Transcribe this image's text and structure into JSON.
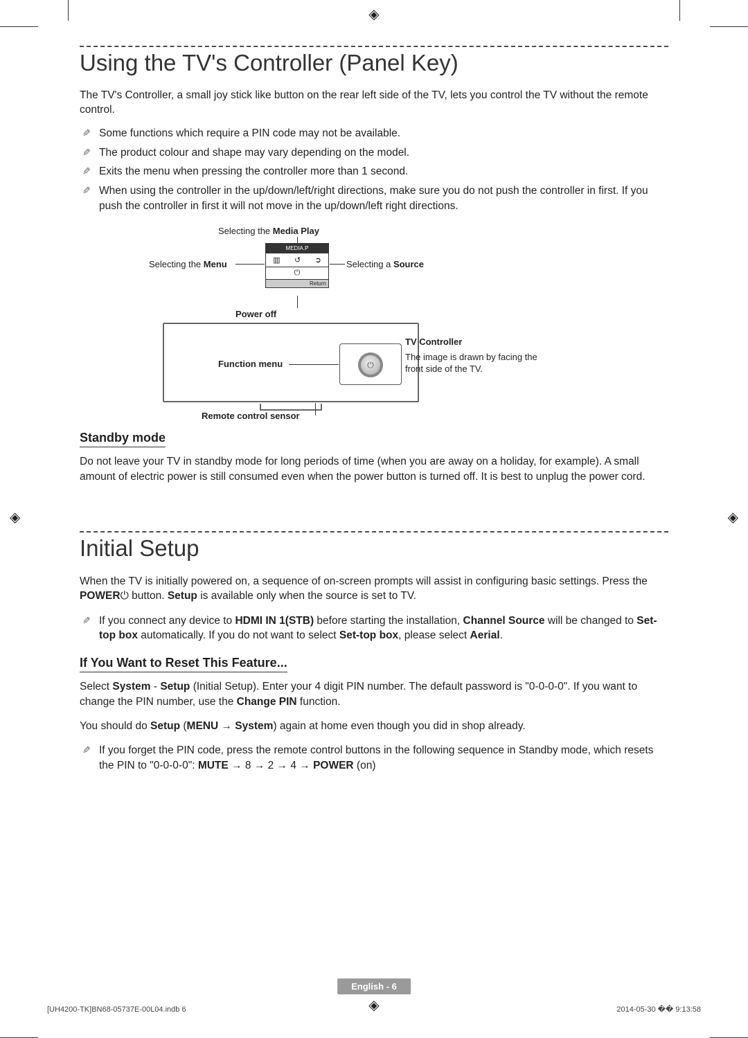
{
  "section1": {
    "title": "Using the TV's Controller (Panel Key)",
    "intro": "The TV's Controller, a small joy stick like button on the rear left side of the TV, lets you control the TV without the remote control.",
    "notes": [
      "Some functions which require a PIN code may not be available.",
      "The product colour and shape may vary depending on the model.",
      "Exits the menu when pressing the controller more than 1 second.",
      "When using the controller in the up/down/left/right directions, make sure you do not push the controller in first. If you push the controller in first it will not move in the up/down/left right directions."
    ],
    "diagram": {
      "media_play_prefix": "Selecting the ",
      "media_play_bold": "Media Play",
      "menu_prefix": "Selecting the ",
      "menu_bold": "Menu",
      "source_prefix": "Selecting a ",
      "source_bold": "Source",
      "power_off": "Power off",
      "function_menu": "Function menu",
      "remote_sensor": "Remote control sensor",
      "tv_controller": "TV Controller",
      "tv_controller_desc": "The image is drawn by facing the front side of the TV.",
      "menu_header": "MEDIA.P",
      "menu_return": "Return"
    },
    "standby_heading": "Standby mode",
    "standby_text": "Do not leave your TV in standby mode for long periods of time (when you are away on a holiday, for example). A small amount of electric power is still consumed even when the power button is turned off. It is best to unplug the power cord."
  },
  "section2": {
    "title": "Initial Setup",
    "intro_pre": "When the TV is initially powered on, a sequence of on-screen prompts will assist in configuring basic settings. Press the ",
    "intro_power": "POWER",
    "intro_mid": " button. ",
    "intro_setup": "Setup",
    "intro_post": " is available only when the source is set to TV.",
    "note1_pre": "If you connect any device to ",
    "note1_hdmi": "HDMI IN 1(STB)",
    "note1_mid": " before starting the installation, ",
    "note1_chsrc": "Channel Source",
    "note1_mid2": " will be changed to ",
    "note1_stb": "Set-top box",
    "note1_mid3": " automatically. If you do not want to select ",
    "note1_stb2": "Set-top box",
    "note1_mid4": ", please select ",
    "note1_aerial": "Aerial",
    "note1_end": ".",
    "reset_heading": "If You Want to Reset This Feature...",
    "reset_p1_pre": "Select ",
    "reset_p1_system": "System",
    "reset_p1_dash": " - ",
    "reset_p1_setup": "Setup",
    "reset_p1_mid": " (Initial Setup). Enter your 4 digit PIN number. The default password is \"0-0-0-0\". If you want to change the PIN number, use the ",
    "reset_p1_change": "Change PIN",
    "reset_p1_end": " function.",
    "reset_p2_pre": "You should do ",
    "reset_p2_setup": "Setup",
    "reset_p2_paren_open": " (",
    "reset_p2_menu": "MENU",
    "reset_p2_arrow": " → ",
    "reset_p2_system": "System",
    "reset_p2_end": ") again at home even though you did in shop already.",
    "note2_pre": "If you forget the PIN code, press the remote control buttons in the following sequence in Standby mode, which resets the PIN to \"0-0-0-0\": ",
    "note2_mute": "MUTE",
    "note2_seq": " → 8 → 2 → 4 → ",
    "note2_power": "POWER",
    "note2_end": " (on)"
  },
  "footer": {
    "page_label": "English - 6",
    "doc_left": "[UH4200-TK]BN68-05737E-00L04.indb   6",
    "doc_right": "2014-05-30   �� 9:13:58"
  }
}
